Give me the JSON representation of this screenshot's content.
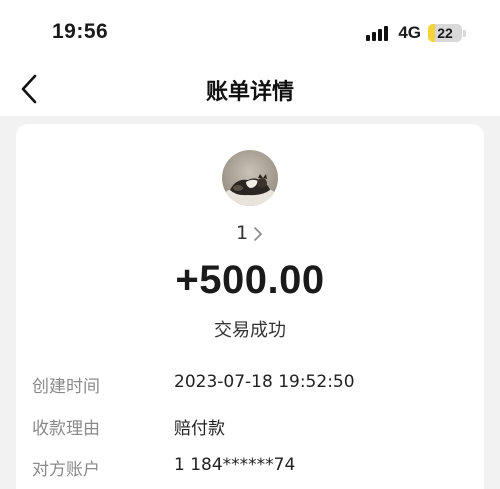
{
  "status_bar": {
    "time": "19:56",
    "network": "4G",
    "battery": "22",
    "battery_level": 0.22,
    "battery_color": "#f7d23a"
  },
  "nav": {
    "back_icon": "chevron-left-icon",
    "title": "账单详情"
  },
  "transaction": {
    "payer_name": "1",
    "payer_chevron_icon": "chevron-right-icon",
    "amount": "+500.00",
    "status": "交易成功",
    "details": [
      {
        "label": "创建时间",
        "value": "2023-07-18 19:52:50"
      },
      {
        "label": "收款理由",
        "value": "赔付款"
      },
      {
        "label": "对方账户",
        "value": "1 184******74"
      }
    ]
  }
}
